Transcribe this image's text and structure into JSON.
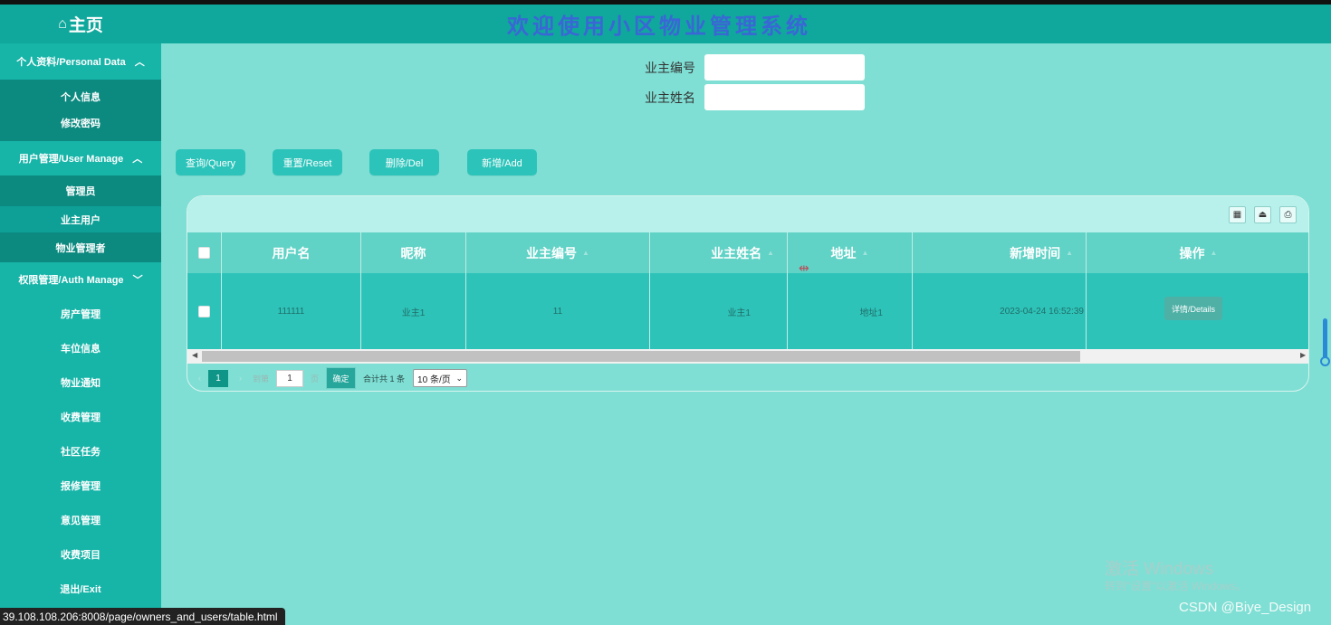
{
  "app": {
    "home_label": "主页",
    "header_title": "欢迎使用小区物业管理系统"
  },
  "sidebar": {
    "groups": [
      {
        "label": "个人资料/Personal Data",
        "expanded": true,
        "items": [
          "个人信息",
          "修改密码"
        ]
      },
      {
        "label": "用户管理/User Manage",
        "expanded": true,
        "items": [
          "管理员",
          "业主用户",
          "物业管理者"
        ],
        "active": "业主用户"
      },
      {
        "label": "权限管理/Auth Manage",
        "expanded": false
      }
    ],
    "items": [
      "房产管理",
      "车位信息",
      "物业通知",
      "收费管理",
      "社区任务",
      "报修管理",
      "意见管理",
      "收费项目",
      "退出/Exit"
    ]
  },
  "search": {
    "owner_no_label": "业主编号",
    "owner_no_value": "",
    "owner_name_label": "业主姓名",
    "owner_name_value": ""
  },
  "actions": {
    "query": "查询/Query",
    "reset": "重置/Reset",
    "delete": "删除/Del",
    "add": "新增/Add"
  },
  "table": {
    "columns": [
      "用户名",
      "昵称",
      "业主编号",
      "业主姓名",
      "地址",
      "新增时间",
      "操作"
    ],
    "rows": [
      {
        "username": "111111",
        "nickname": "业主1",
        "owner_no": "11",
        "owner_name": "业主1",
        "address": "地址1",
        "created": "2023-04-24 16:52:39",
        "action": "详情/Details"
      }
    ]
  },
  "pager": {
    "current_page": "1",
    "goto_label": "到第",
    "goto_value": "1",
    "page_suffix": "页",
    "confirm": "确定",
    "total": "合计共 1 条",
    "page_size": "10 条/页"
  },
  "overlay": {
    "activate_title": "激活 Windows",
    "activate_hint": "转到\"设置\"以激活 Windows。",
    "watermark": "CSDN @Biye_Design",
    "status_url": "39.108.108.206:8008/page/owners_and_users/table.html"
  },
  "colors": {
    "sidebar": "#17b4a8",
    "sidebar_sub": "#0c8a80",
    "header": "#10a89c",
    "content_bg": "#7fdfd4",
    "button": "#2cc4ba",
    "title_text": "#3a66d6"
  }
}
